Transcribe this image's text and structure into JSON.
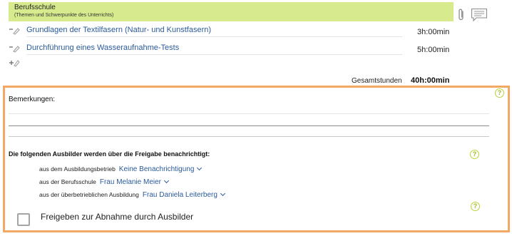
{
  "section": {
    "title": "Berufsschule",
    "subtitle": "(Themen und Schwerpunkte des Unterrichts)"
  },
  "icons": {
    "attachment": "paperclip-icon",
    "comment": "comment-icon",
    "edit": "edit-topic-icon",
    "add": "add-topic-icon",
    "help": "help-icon"
  },
  "topics": [
    {
      "title": "Grundlagen der Textilfasern (Natur- und Kunstfasern)",
      "hours": "3h:00min"
    },
    {
      "title": "Durchführung eines Wasseraufnahme-Tests",
      "hours": "5h:00min"
    }
  ],
  "total": {
    "label": "Gesamtstunden",
    "value": "40h:00min"
  },
  "remarks": {
    "label": "Bemerkungen:",
    "value": ""
  },
  "notify": {
    "heading": "Die folgenden Ausbilder werden über die Freigabe benachrichtigt:",
    "rows": [
      {
        "label": "aus dem Ausbildungsbetrieb",
        "value": "Keine Benachrichtigung"
      },
      {
        "label": "aus der Berufsschule",
        "value": "Frau Melanie Meier"
      },
      {
        "label": "aus der überbetrieblichen Ausbildung",
        "value": "Frau Daniela Leiterberg"
      }
    ]
  },
  "release": {
    "label": "Freigeben zur Abnahme durch Ausbilder",
    "checked": false
  },
  "colors": {
    "header_bg": "#d7ea8e",
    "panel_border": "#f3a964",
    "link": "#2b5a9a",
    "help": "#b8d43a"
  }
}
